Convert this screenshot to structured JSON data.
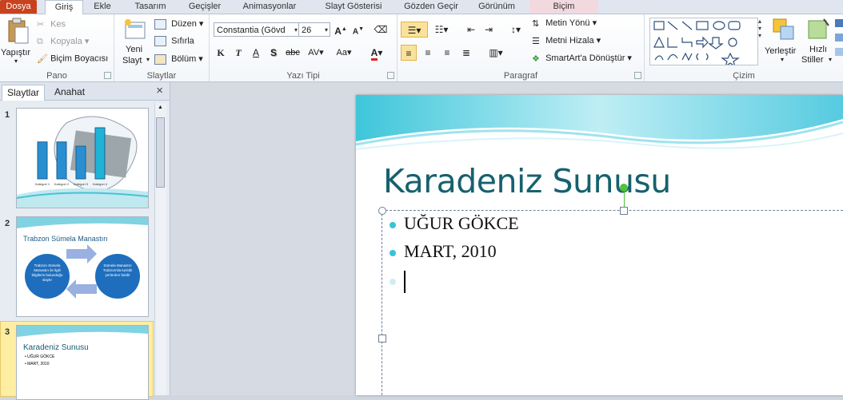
{
  "tabs": [
    "Dosya",
    "Giriş",
    "Ekle",
    "Tasarım",
    "Geçişler",
    "Animasyonlar",
    "Slayt Gösterisi",
    "Gözden Geçir",
    "Görünüm",
    "Biçim"
  ],
  "ribbon": {
    "pano": {
      "label": "Pano",
      "paste": "Yapıştır",
      "cut": "Kes",
      "copy": "Kopyala",
      "painter": "Biçim Boyacısı"
    },
    "slaytlar": {
      "label": "Slaytlar",
      "new_slide_1": "Yeni",
      "new_slide_2": "Slayt",
      "layout": "Düzen",
      "reset": "Sıfırla",
      "section": "Bölüm"
    },
    "yazi": {
      "label": "Yazı Tipi",
      "font": "Constantia (Gövd",
      "size": "26",
      "bold": "K",
      "italic": "T",
      "underline": "A",
      "shadow": "S",
      "strike": "abc",
      "spacing": "AV",
      "case": "Aa",
      "color": "A"
    },
    "paragraf": {
      "label": "Paragraf",
      "text_dir": "Metin Yönü",
      "align_text": "Metni Hizala",
      "smartart": "SmartArt'a Dönüştür"
    },
    "cizim": {
      "label": "Çizim",
      "arrange": "Yerleştir",
      "quick_1": "Hızlı",
      "quick_2": "Stiller"
    }
  },
  "panel": {
    "tab_slides": "Slaytlar",
    "tab_outline": "Anahat",
    "close": "×"
  },
  "thumbs": [
    {
      "num": "1",
      "categories": [
        "Kategori 1",
        "Kategori 2",
        "Kategori 3",
        "Kategori 4"
      ],
      "values": [
        2.6,
        2.6,
        2.3,
        3.6
      ],
      "ymax": 4.5
    },
    {
      "num": "2",
      "title": "Trabzon Sümela Manastırı",
      "circle_left": "Trabzon Sümela Manastırı ile ilgili bilgilerin bulunduğu slaytır",
      "circle_right": "Sümela Manastırı Trabzon'da turistik yerlerden biridir"
    },
    {
      "num": "3",
      "title": "Karadeniz Sunusu",
      "bullets": [
        "UĞUR GÖKCE",
        "MART, 2010"
      ]
    }
  ],
  "slide": {
    "title": "Karadeniz Sunusu",
    "bullets": [
      "UĞUR GÖKCE",
      "MART, 2010"
    ]
  },
  "colors": {
    "accent": "#35c4d8",
    "title": "#16616e",
    "file_tab": "#c8421d",
    "selection": "#fbe29a"
  }
}
